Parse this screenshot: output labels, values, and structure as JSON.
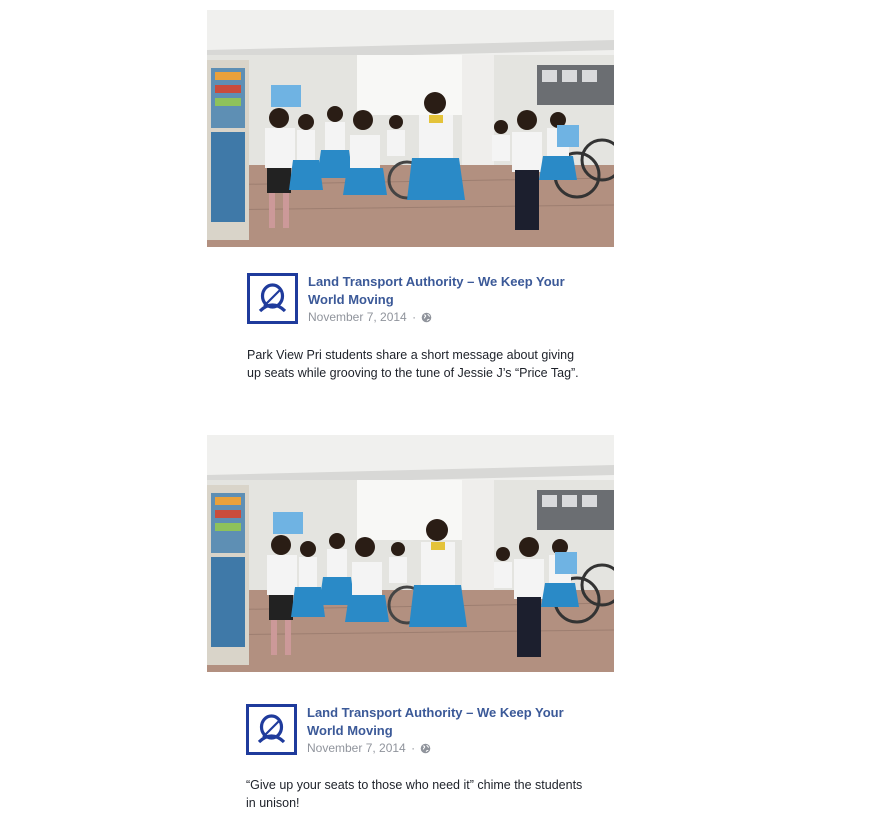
{
  "posts": [
    {
      "image_icon": "photo-students-dancing",
      "page_name": "Land Transport Authority – We Keep Your World Moving",
      "date": "November 7, 2014",
      "separator": "·",
      "privacy_icon": "globe-icon",
      "caption": "Park View Pri students share a short message about giving up seats while grooving to the tune of Jessie J’s “Price Tag”."
    },
    {
      "image_icon": "photo-students-dancing",
      "page_name": "Land Transport Authority – We Keep Your World Moving",
      "date": "November 7, 2014",
      "separator": "·",
      "privacy_icon": "globe-icon",
      "caption": "“Give up your seats to those who need it” chime the students in unison!"
    }
  ],
  "colors": {
    "link": "#3b5998",
    "meta": "#90949c",
    "logo_blue": "#1f3b9c",
    "skirt_blue": "#2a8ac7"
  }
}
